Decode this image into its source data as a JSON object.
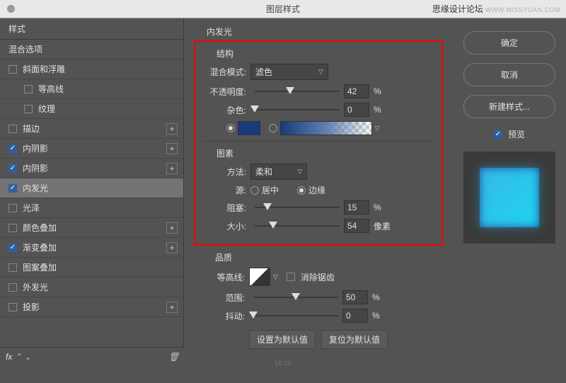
{
  "titlebar": {
    "title": "图层样式",
    "watermark_main": "思缘设计论坛",
    "watermark_sub": "WWW.MISSYUAN.COM"
  },
  "sidebar": {
    "header": "样式",
    "blend_options": "混合选项",
    "items": [
      {
        "label": "斜面和浮雕",
        "checked": false,
        "plus": false,
        "sub": false
      },
      {
        "label": "等高线",
        "checked": false,
        "plus": false,
        "sub": true
      },
      {
        "label": "纹理",
        "checked": false,
        "plus": false,
        "sub": true
      },
      {
        "label": "描边",
        "checked": false,
        "plus": true,
        "sub": false
      },
      {
        "label": "内阴影",
        "checked": true,
        "plus": true,
        "sub": false
      },
      {
        "label": "内阴影",
        "checked": true,
        "plus": true,
        "sub": false
      },
      {
        "label": "内发光",
        "checked": true,
        "plus": false,
        "sub": false,
        "selected": true
      },
      {
        "label": "光泽",
        "checked": false,
        "plus": false,
        "sub": false
      },
      {
        "label": "颜色叠加",
        "checked": false,
        "plus": true,
        "sub": false
      },
      {
        "label": "渐变叠加",
        "checked": true,
        "plus": true,
        "sub": false
      },
      {
        "label": "图案叠加",
        "checked": false,
        "plus": false,
        "sub": false
      },
      {
        "label": "外发光",
        "checked": false,
        "plus": false,
        "sub": false
      },
      {
        "label": "投影",
        "checked": false,
        "plus": true,
        "sub": false
      }
    ],
    "fx": "fx"
  },
  "panel": {
    "section": "内发光",
    "structure": {
      "title": "结构",
      "blend_mode_label": "混合模式:",
      "blend_mode_value": "滤色",
      "opacity_label": "不透明度:",
      "opacity_value": "42",
      "opacity_unit": "%",
      "noise_label": "杂色:",
      "noise_value": "0",
      "noise_unit": "%"
    },
    "elements": {
      "title": "图素",
      "technique_label": "方法:",
      "technique_value": "柔和",
      "source_label": "源:",
      "source_center": "居中",
      "source_edge": "边缘",
      "choke_label": "阻塞:",
      "choke_value": "15",
      "choke_unit": "%",
      "size_label": "大小:",
      "size_value": "54",
      "size_unit": "像素"
    },
    "quality": {
      "title": "品质",
      "contour_label": "等高线:",
      "antialias_label": "消除锯齿",
      "range_label": "范围:",
      "range_value": "50",
      "range_unit": "%",
      "jitter_label": "抖动:",
      "jitter_value": "0",
      "jitter_unit": "%"
    },
    "buttons": {
      "default": "设置为默认值",
      "reset": "复位为默认值"
    }
  },
  "right": {
    "ok": "确定",
    "cancel": "取消",
    "new_style": "新建样式...",
    "preview": "预览"
  },
  "watermark2": "UI.cn"
}
